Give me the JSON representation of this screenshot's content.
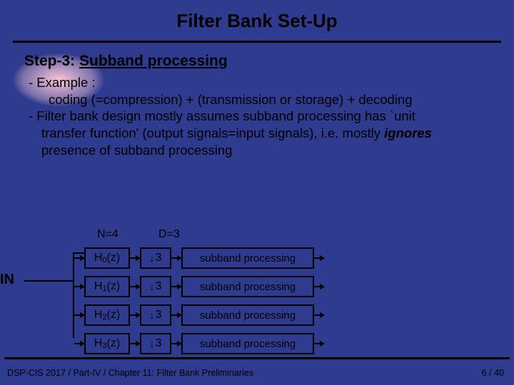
{
  "title": "Filter Bank Set-Up",
  "step": {
    "prefix": "Step-3: ",
    "label": "Subband processing"
  },
  "body": {
    "l1": "- Example :",
    "l2": "coding (=compression) + (transmission or storage) + decoding",
    "l3": "- Filter bank design mostly assumes subband processing has `unit",
    "l4": "transfer function' (output signals=input signals), i.e. mostly ",
    "l4b": "ignores",
    "l5": "presence of subband processing"
  },
  "diagram": {
    "in": "IN",
    "n_label": "N=4",
    "d_label": "D=3",
    "rows": [
      {
        "h": "H0(z)",
        "d": "3",
        "sp": "subband processing"
      },
      {
        "h": "H1(z)",
        "d": "3",
        "sp": "subband processing"
      },
      {
        "h": "H2(z)",
        "d": "3",
        "sp": "subband processing"
      },
      {
        "h": "H3(z)",
        "d": "3",
        "sp": "subband processing"
      }
    ]
  },
  "footer": {
    "left": "DSP-CIS 2017  / Part-IV  /  Chapter 11: Filter Bank Preliminaries",
    "right": "6 / 40"
  }
}
